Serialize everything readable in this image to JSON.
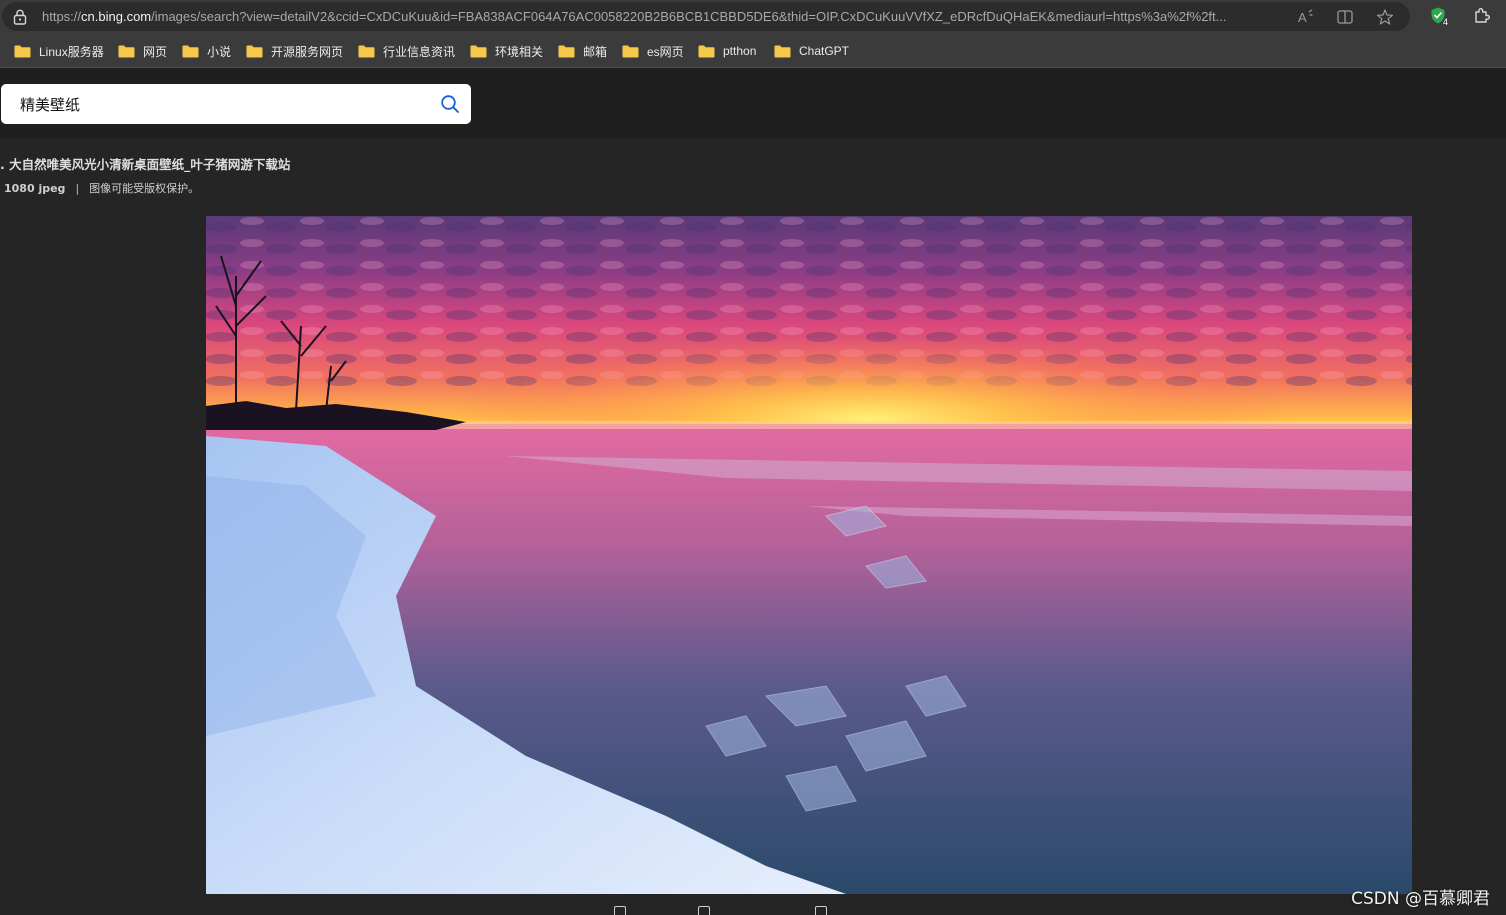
{
  "browser": {
    "url_prefix": "https://",
    "url_host": "cn.bing.com",
    "url_rest": "/images/search?view=detailV2&ccid=CxDCuKuu&id=FBA838ACF064A76AC0058220B2B6BCB1CBBD5DE6&thid=OIP.CxDCuKuuVVfXZ_eDRcfDuQHaEK&mediaurl=https%3a%2f%2ft...",
    "extension_badge": "4"
  },
  "bookmarks": [
    {
      "label": "Linux服务器"
    },
    {
      "label": "网页"
    },
    {
      "label": "小说"
    },
    {
      "label": "开源服务网页"
    },
    {
      "label": "行业信息资讯"
    },
    {
      "label": "环境相关"
    },
    {
      "label": "邮箱"
    },
    {
      "label": "es网页"
    },
    {
      "label": "ptthon"
    },
    {
      "label": "ChatGPT"
    }
  ],
  "search": {
    "value": "精美壁纸"
  },
  "image": {
    "title": ". 大自然唯美风光小清新桌面壁纸_叶子猪网游下载站",
    "resolution": "1080 jpeg",
    "separator": "|",
    "copyright": "图像可能受版权保护。"
  },
  "watermark": "CSDN @百慕卿君",
  "colors": {
    "page_bg": "#252525",
    "header_bg": "#1f1f1f",
    "chrome_bg": "#3b3b3b",
    "folder_yellow": "#f4c84a",
    "security_green": "#2fa84f"
  }
}
